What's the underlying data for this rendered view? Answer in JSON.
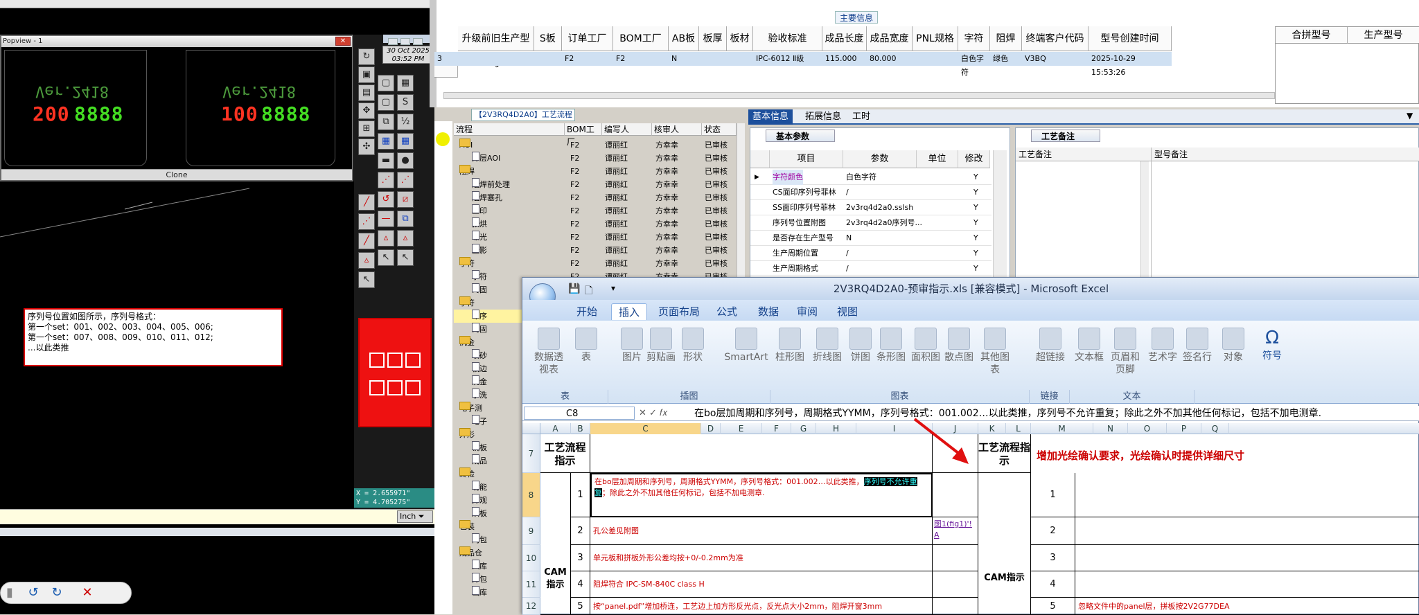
{
  "cam": {
    "popview_title": "Popview - 1",
    "screen_left": {
      "ver": "Ver.2418",
      "num": "8888",
      "num_red": "200"
    },
    "screen_right": {
      "ver": "Ver.2418",
      "num": "8888",
      "num_red": "100"
    },
    "clone_label": "Clone",
    "date_line1": "30 Oct 2025",
    "date_line2": "03:52 PM",
    "note_text": "序列号位置如图所示，序列号格式：\n第一个set：001、002、003、004、005、006;\n第一个set：007、008、009、010、011、012;\n...以此类推",
    "coord_x": "X = 2.655971\"",
    "coord_y": "Y = 4.705275\"",
    "unit_label": "Inch"
  },
  "top_table": {
    "section_title": "主要信息",
    "headers": [
      "升级前旧生产型号",
      "S板",
      "订单工厂",
      "BOM工厂",
      "AB板",
      "板厚",
      "板材",
      "验收标准",
      "成品长度",
      "成品宽度",
      "PNL规格",
      "字符",
      "阻焊",
      "终端客户代码",
      "型号创建时间"
    ],
    "row": [
      "",
      "",
      "F2",
      "F2",
      "N",
      "",
      "",
      "IPC-6012 Ⅱ级",
      "115.000",
      "80.000",
      "",
      "白色字符",
      "绿色",
      "V3BQ",
      "2025-10-29 15:53:26"
    ],
    "row_prefix": "3",
    "right_headers": [
      "合拼型号",
      "生产型号"
    ]
  },
  "process": {
    "title": "【2V3RQ4D2A0】工艺流程",
    "headers": [
      "流程",
      "BOM工厂",
      "编写人",
      "核审人",
      "状态"
    ],
    "rows": [
      {
        "level": 1,
        "type": "folder",
        "name": "AOI",
        "bom": "F2",
        "writer": "谭丽红",
        "reviewer": "方幸幸",
        "status": "已审核"
      },
      {
        "level": 2,
        "type": "leaf",
        "name": "外层AOI",
        "bom": "F2",
        "writer": "谭丽红",
        "reviewer": "方幸幸",
        "status": "已审核"
      },
      {
        "level": 1,
        "type": "folder",
        "name": "阻焊",
        "bom": "F2",
        "writer": "谭丽红",
        "reviewer": "方幸幸",
        "status": "已审核"
      },
      {
        "level": 2,
        "type": "leaf",
        "name": "阻焊前处理",
        "bom": "F2",
        "writer": "谭丽红",
        "reviewer": "方幸幸",
        "status": "已审核"
      },
      {
        "level": 2,
        "type": "leaf",
        "name": "阻焊塞孔",
        "bom": "F2",
        "writer": "谭丽红",
        "reviewer": "方幸幸",
        "status": "已审核"
      },
      {
        "level": 2,
        "type": "leaf",
        "name": "丝印",
        "bom": "F2",
        "writer": "谭丽红",
        "reviewer": "方幸幸",
        "status": "已审核"
      },
      {
        "level": 2,
        "type": "leaf",
        "name": "预烘",
        "bom": "F2",
        "writer": "谭丽红",
        "reviewer": "方幸幸",
        "status": "已审核"
      },
      {
        "level": 2,
        "type": "leaf",
        "name": "曝光",
        "bom": "F2",
        "writer": "谭丽红",
        "reviewer": "方幸幸",
        "status": "已审核"
      },
      {
        "level": 2,
        "type": "leaf",
        "name": "显影",
        "bom": "F2",
        "writer": "谭丽红",
        "reviewer": "方幸幸",
        "status": "已审核"
      },
      {
        "level": 1,
        "type": "folder",
        "name": "字符",
        "bom": "F2",
        "writer": "谭丽红",
        "reviewer": "方幸幸",
        "status": "已审核"
      },
      {
        "level": 2,
        "type": "leaf",
        "name": "字符",
        "bom": "F2",
        "writer": "谭丽红",
        "reviewer": "方幸幸",
        "status": "已审核"
      },
      {
        "level": 2,
        "type": "leaf",
        "name": "终固",
        "bom": "",
        "writer": "",
        "reviewer": "",
        "status": ""
      },
      {
        "level": 1,
        "type": "folder",
        "name": "字符",
        "bom": "",
        "writer": "",
        "reviewer": "",
        "status": ""
      },
      {
        "level": 2,
        "type": "leaf",
        "name": "印序",
        "bom": "",
        "writer": "",
        "reviewer": "",
        "status": ""
      },
      {
        "level": 2,
        "type": "leaf",
        "name": "终固",
        "bom": "",
        "writer": "",
        "reviewer": "",
        "status": ""
      },
      {
        "level": 1,
        "type": "folder",
        "name": "沉金",
        "bom": "",
        "writer": "",
        "reviewer": "",
        "status": ""
      },
      {
        "level": 2,
        "type": "leaf",
        "name": "喷砂",
        "bom": "",
        "writer": "",
        "reviewer": "",
        "status": ""
      },
      {
        "level": 2,
        "type": "leaf",
        "name": "板边",
        "bom": "",
        "writer": "",
        "reviewer": "",
        "status": ""
      },
      {
        "level": 2,
        "type": "leaf",
        "name": "沉金",
        "bom": "",
        "writer": "",
        "reviewer": "",
        "status": ""
      },
      {
        "level": 2,
        "type": "leaf",
        "name": "水洗",
        "bom": "",
        "writer": "",
        "reviewer": "",
        "status": ""
      },
      {
        "level": 1,
        "type": "folder",
        "name": "电子测",
        "bom": "",
        "writer": "",
        "reviewer": "",
        "status": ""
      },
      {
        "level": 2,
        "type": "leaf",
        "name": "电子",
        "bom": "",
        "writer": "",
        "reviewer": "",
        "status": ""
      },
      {
        "level": 1,
        "type": "folder",
        "name": "外形",
        "bom": "",
        "writer": "",
        "reviewer": "",
        "status": ""
      },
      {
        "level": 2,
        "type": "leaf",
        "name": "铣板",
        "bom": "",
        "writer": "",
        "reviewer": "",
        "status": ""
      },
      {
        "level": 2,
        "type": "leaf",
        "name": "成品",
        "bom": "",
        "writer": "",
        "reviewer": "",
        "status": ""
      },
      {
        "level": 1,
        "type": "folder",
        "name": "终检",
        "bom": "",
        "writer": "",
        "reviewer": "",
        "status": ""
      },
      {
        "level": 2,
        "type": "leaf",
        "name": "功能",
        "bom": "",
        "writer": "",
        "reviewer": "",
        "status": ""
      },
      {
        "level": 2,
        "type": "leaf",
        "name": "外观",
        "bom": "",
        "writer": "",
        "reviewer": "",
        "status": ""
      },
      {
        "level": 2,
        "type": "leaf",
        "name": "烘板",
        "bom": "",
        "writer": "",
        "reviewer": "",
        "status": ""
      },
      {
        "level": 1,
        "type": "folder",
        "name": "包装",
        "bom": "",
        "writer": "",
        "reviewer": "",
        "status": ""
      },
      {
        "level": 2,
        "type": "leaf",
        "name": "内包",
        "bom": "",
        "writer": "",
        "reviewer": "",
        "status": ""
      },
      {
        "level": 1,
        "type": "folder",
        "name": "成品仓",
        "bom": "",
        "writer": "",
        "reviewer": "",
        "status": ""
      },
      {
        "level": 2,
        "type": "leaf",
        "name": "入库",
        "bom": "",
        "writer": "",
        "reviewer": "",
        "status": ""
      },
      {
        "level": 2,
        "type": "leaf",
        "name": "外包",
        "bom": "",
        "writer": "",
        "reviewer": "",
        "status": ""
      },
      {
        "level": 2,
        "type": "leaf",
        "name": "出库",
        "bom": "",
        "writer": "",
        "reviewer": "",
        "status": ""
      }
    ]
  },
  "info": {
    "tabs": [
      "基本信息",
      "拓展信息",
      "工时"
    ],
    "basic_title": "基本参数",
    "headers": [
      "项目",
      "参数",
      "单位",
      "修改"
    ],
    "rows": [
      {
        "item": "字符颜色",
        "param": "白色字符",
        "unit": "",
        "mod": "Y"
      },
      {
        "item": "CS面印序列号菲林",
        "param": "/",
        "unit": "",
        "mod": "Y"
      },
      {
        "item": "SS面印序列号菲林",
        "param": "2v3rq4d2a0.sslsh",
        "unit": "",
        "mod": "Y"
      },
      {
        "item": "序列号位置附图",
        "param": "2v3rq4d2a0序列号...",
        "unit": "",
        "mod": "Y"
      },
      {
        "item": "是否存在生产型号",
        "param": "N",
        "unit": "",
        "mod": "Y"
      },
      {
        "item": "生产周期位置",
        "param": "/",
        "unit": "",
        "mod": "Y"
      },
      {
        "item": "生产周期格式",
        "param": "/",
        "unit": "",
        "mod": "Y"
      }
    ],
    "note_title": "工艺备注",
    "note_col1": "工艺备注",
    "note_col2": "型号备注"
  },
  "excel": {
    "title": "2V3RQ4D2A0-预审指示.xls [兼容模式] - Microsoft Excel",
    "tabs": [
      "开始",
      "插入",
      "页面布局",
      "公式",
      "数据",
      "审阅",
      "视图"
    ],
    "active_tab": "插入",
    "ribbon_buttons": [
      "数据透视表",
      "表",
      "图片",
      "剪贴画",
      "形状",
      "SmartArt",
      "柱形图",
      "折线图",
      "饼图",
      "条形图",
      "面积图",
      "散点图",
      "其他图表",
      "超链接",
      "文本框",
      "页眉和页脚",
      "艺术字",
      "签名行",
      "对象",
      "符号"
    ],
    "groups": [
      "表",
      "插图",
      "图表",
      "链接",
      "文本"
    ],
    "name_box": "C8",
    "formula": "在bo层加周期和序列号，周期格式YYMM，序列号格式：001.002…以此类推，序列号不允许重复；除此之外不加其他任何标记，包括不加电测章.",
    "columns": [
      "A",
      "B",
      "C",
      "D",
      "E",
      "F",
      "G",
      "H",
      "I",
      "J",
      "K",
      "L",
      "M",
      "N",
      "O",
      "P",
      "Q"
    ],
    "row_numbers": [
      "7",
      "8",
      "9",
      "10",
      "11",
      "12"
    ],
    "left_header": "工艺流程指示",
    "right_header": "工艺流程指示",
    "cam_label": "CAM指示",
    "right_cam_label": "CAM指示",
    "top_right_text": "增加光绘确认要求，光绘确认时提供详细尺寸",
    "items": [
      {
        "n": "1",
        "text_a": "在bo层加周期和序列号，周期格式YYMM，序列号格式：001.002…以此类推，",
        "hl": "序列号不允许重复",
        "text_b": "；除此之外不加其他任何标记，包括不加电测章."
      },
      {
        "n": "2",
        "text": "孔公差见附图",
        "link": "图1(fig1)'!A"
      },
      {
        "n": "3",
        "text": "单元板和拼板外形公差均按+0/-0.2mm为准"
      },
      {
        "n": "4",
        "text": "阻焊符合 IPC-SM-840C class H"
      },
      {
        "n": "5",
        "text": "按“panel.pdf”增加桥连，工艺边上加方形反光点，反光点大小2mm，阻焊开窗3mm"
      }
    ],
    "right_items": [
      "1",
      "2",
      "3",
      "4",
      "5"
    ],
    "right_item5": "忽略文件中的panel层，拼板按2V2G77DEA"
  }
}
